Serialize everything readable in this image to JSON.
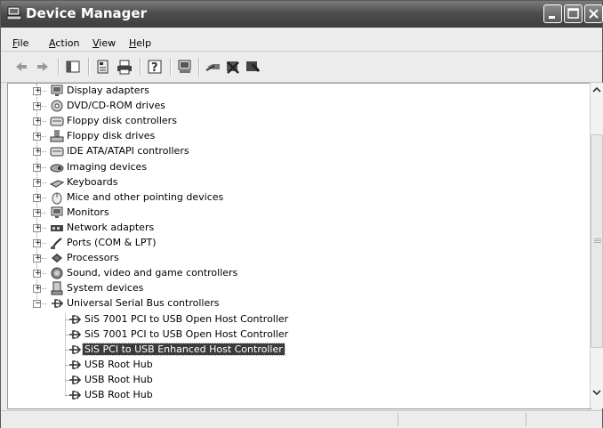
{
  "window": {
    "title": "Device Manager",
    "title_icon": "computer-icon"
  },
  "titlebar_buttons": [
    "minimize-icon",
    "maximize-icon",
    "close-icon"
  ],
  "menu": [
    {
      "label": "File",
      "accel": "F",
      "rest": "ile"
    },
    {
      "label": "Action",
      "accel": "A",
      "rest": "ction"
    },
    {
      "label": "View",
      "accel": "V",
      "rest": "iew"
    },
    {
      "label": "Help",
      "accel": "H",
      "rest": "elp"
    }
  ],
  "toolbar": [
    "back-arrow-icon",
    "forward-arrow-icon",
    "show-hide-console-tree-icon",
    "properties-icon",
    "print-icon",
    "help-icon",
    "scan-hardware-changes-icon",
    "update-driver-icon",
    "uninstall-icon",
    "disable-icon"
  ],
  "tree": {
    "categories": [
      {
        "label": "Display adapters",
        "icon": "monitor-icon",
        "expanded": false
      },
      {
        "label": "DVD/CD-ROM drives",
        "icon": "cd-drive-icon",
        "expanded": false
      },
      {
        "label": "Floppy disk controllers",
        "icon": "disk-controller-icon",
        "expanded": false
      },
      {
        "label": "Floppy disk drives",
        "icon": "floppy-drive-icon",
        "expanded": false
      },
      {
        "label": "IDE ATA/ATAPI controllers",
        "icon": "disk-controller-icon",
        "expanded": false
      },
      {
        "label": "Imaging devices",
        "icon": "camera-icon",
        "expanded": false
      },
      {
        "label": "Keyboards",
        "icon": "keyboard-icon",
        "expanded": false
      },
      {
        "label": "Mice and other pointing devices",
        "icon": "mouse-icon",
        "expanded": false
      },
      {
        "label": "Monitors",
        "icon": "monitor-icon",
        "expanded": false
      },
      {
        "label": "Network adapters",
        "icon": "network-card-icon",
        "expanded": false
      },
      {
        "label": "Ports (COM & LPT)",
        "icon": "port-icon",
        "expanded": false
      },
      {
        "label": "Processors",
        "icon": "processor-icon",
        "expanded": false
      },
      {
        "label": "Sound, video and game controllers",
        "icon": "speaker-icon",
        "expanded": false
      },
      {
        "label": "System devices",
        "icon": "computer-icon",
        "expanded": false
      },
      {
        "label": "Universal Serial Bus controllers",
        "icon": "usb-icon",
        "expanded": true
      }
    ],
    "usb_children": [
      {
        "label": "SiS 7001 PCI to USB Open Host Controller",
        "selected": false
      },
      {
        "label": "SiS 7001 PCI to USB Open Host Controller",
        "selected": false
      },
      {
        "label": "SiS PCI to USB Enhanced Host Controller",
        "selected": true
      },
      {
        "label": "USB Root Hub",
        "selected": false
      },
      {
        "label": "USB Root Hub",
        "selected": false
      },
      {
        "label": "USB Root Hub",
        "selected": false
      }
    ]
  },
  "scrollbar": {
    "up": "scroll-up-icon",
    "down": "scroll-down-icon"
  }
}
